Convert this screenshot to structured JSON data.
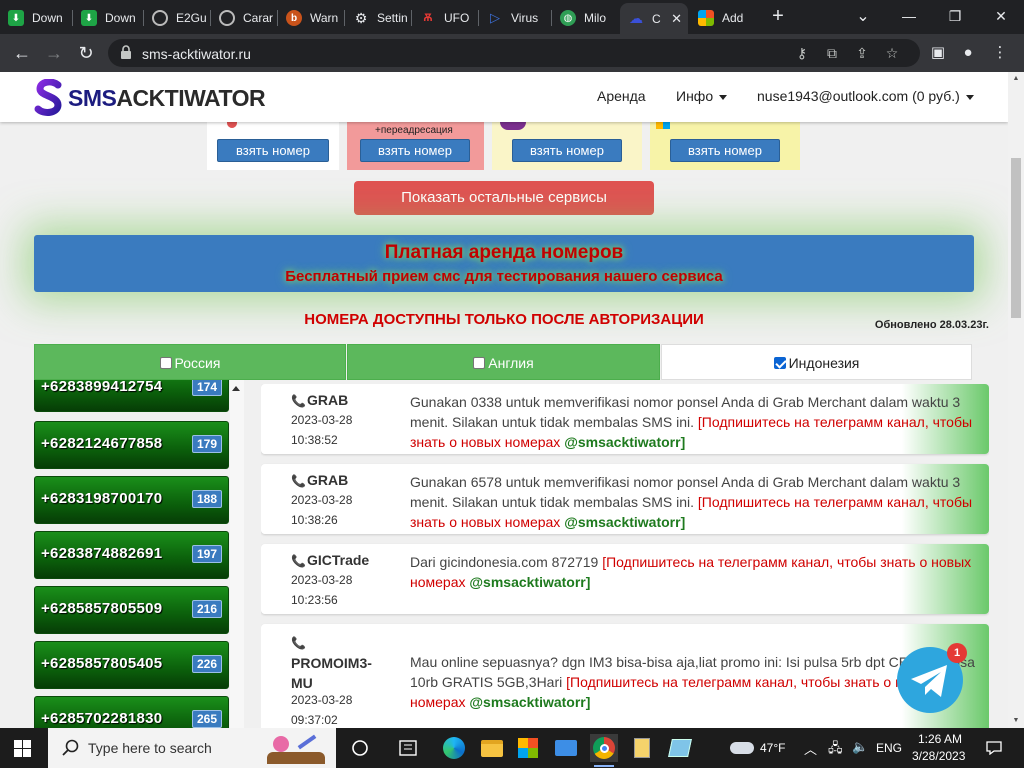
{
  "browser": {
    "tabs": [
      {
        "title": "Down",
        "icon": "download-icon"
      },
      {
        "title": "Down",
        "icon": "download-icon"
      },
      {
        "title": "E2Gu",
        "icon": "globe-icon"
      },
      {
        "title": "Carar",
        "icon": "globe-icon"
      },
      {
        "title": "Warn",
        "icon": "warning-icon"
      },
      {
        "title": "Settin",
        "icon": "gear-icon"
      },
      {
        "title": "UFO",
        "icon": "ufo-icon"
      },
      {
        "title": "Virus",
        "icon": "virustotal-icon"
      },
      {
        "title": "Milo",
        "icon": "milo-icon"
      },
      {
        "title": "C",
        "icon": "smsacktiwator-icon",
        "active": true
      },
      {
        "title": "Add",
        "icon": "microsoft-icon"
      }
    ],
    "url": "sms-acktiwator.ru"
  },
  "site": {
    "logo_prefix": "SMS",
    "logo_suffix": "ACKTIWATOR",
    "nav": {
      "rent": "Аренда",
      "info": "Инфо",
      "account": "nuse1943@outlook.com (0 руб.)"
    },
    "service_cards": [
      {
        "button": "взять номер"
      },
      {
        "button": "взять номер",
        "note": "+переадресация"
      },
      {
        "button": "взять номер"
      },
      {
        "button": "взять номер"
      }
    ],
    "show_more": "Показать остальные сервисы",
    "banner": {
      "line1": "Платная аренда номеров",
      "line2": "Бесплатный прием смс для тестирования нашего сервиса"
    },
    "auth_note": "НОМЕРА ДОСТУПНЫ ТОЛЬКО ПОСЛЕ АВТОРИЗАЦИИ",
    "updated": "Обновлено 28.03.23г.",
    "country_tabs": [
      {
        "label": "Россия",
        "checked": false
      },
      {
        "label": "Англия",
        "checked": false
      },
      {
        "label": "Индонезия",
        "checked": true
      }
    ],
    "numbers": [
      {
        "number": "+6283899412754",
        "count": "174"
      },
      {
        "number": "+6282124677858",
        "count": "179"
      },
      {
        "number": "+6283198700170",
        "count": "188"
      },
      {
        "number": "+6283874882691",
        "count": "197"
      },
      {
        "number": "+6285857805509",
        "count": "216"
      },
      {
        "number": "+6285857805405",
        "count": "226"
      },
      {
        "number": "+6285702281830",
        "count": "265"
      }
    ],
    "messages": [
      {
        "service": "GRAB",
        "date": "2023-03-28",
        "time": "10:38:52",
        "text": "Gunakan 0338 untuk memverifikasi nomor ponsel Anda di Grab Merchant dalam waktu 3 menit. Silakan untuk tidak membalas SMS ini. ",
        "promo": "[Подпишитесь на телеграмм канал, чтобы знать о новых номерах ",
        "tg": "@smsacktiwatorr]"
      },
      {
        "service": "GRAB",
        "date": "2023-03-28",
        "time": "10:38:26",
        "text": "Gunakan 6578 untuk memverifikasi nomor ponsel Anda di Grab Merchant dalam waktu 3 menit. Silakan untuk tidak membalas SMS ini. ",
        "promo": "[Подпишитесь на телеграмм канал, чтобы знать о новых номерах ",
        "tg": "@smsacktiwatorr]"
      },
      {
        "service": "GICTrade",
        "date": "2023-03-28",
        "time": "10:23:56",
        "text": "Dari gicindonesia.com 872719 ",
        "promo": "[Подпишитесь на телеграмм канал, чтобы знать о новых номерах ",
        "tg": "@smsacktiwatorr]"
      },
      {
        "service": "PROMOIM3-MU",
        "date": "2023-03-28",
        "time": "09:37:02",
        "text": "Mau online sepuasnya? dgn IM3 bisa-bisa aja,liat promo ini: Isi pulsa 5rb dpt CE... Isi pulsa 10rb GRATIS 5GB,3Hari ",
        "promo": "[Подпишитесь на телеграмм канал, чтобы знать о новых номерах ",
        "tg": "@smsacktiwatorr]"
      }
    ],
    "telegram_badge": "1"
  },
  "taskbar": {
    "search_placeholder": "Type here to search",
    "weather": "47°F",
    "language": "ENG",
    "time": "1:26 AM",
    "date": "3/28/2023"
  }
}
